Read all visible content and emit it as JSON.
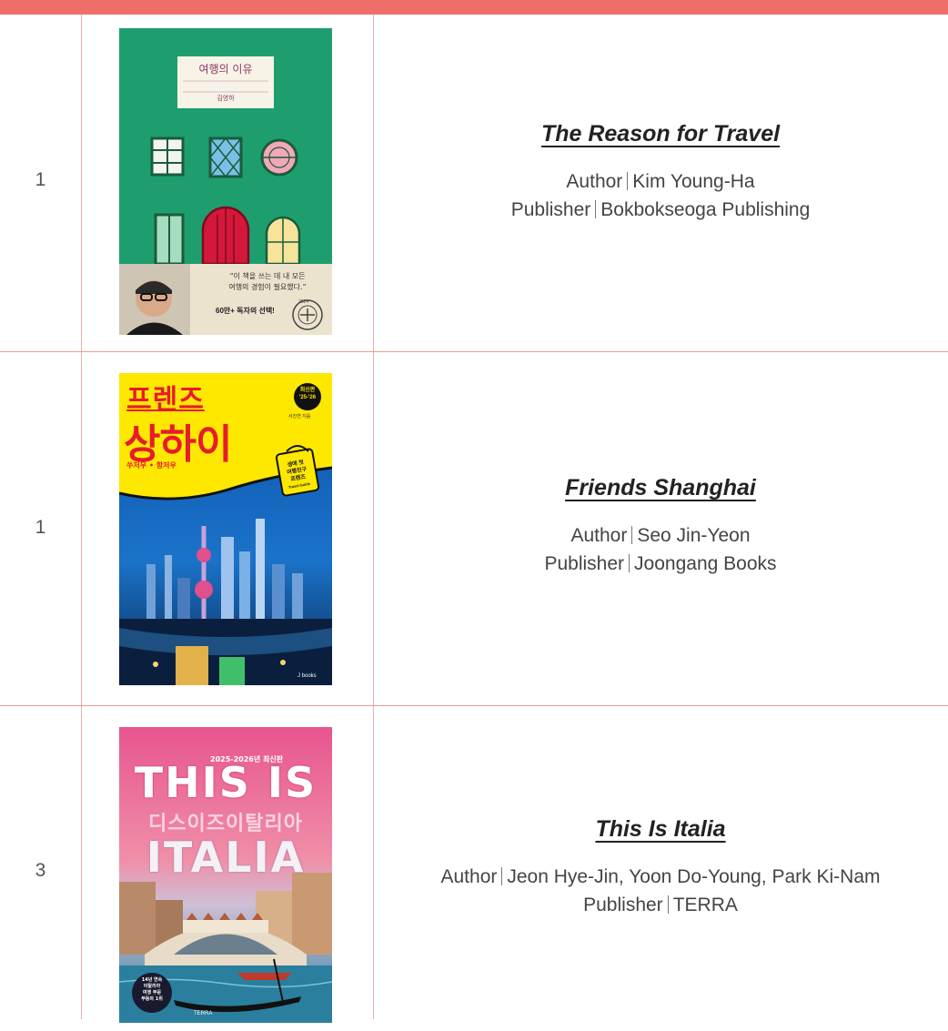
{
  "books": [
    {
      "rank": "1",
      "title": "The Reason for Travel",
      "author_label": "Author",
      "author": "Kim Young-Ha",
      "publisher_label": "Publisher",
      "publisher": "Bokbokseoga Publishing",
      "cover": {
        "title_ko": "여행의 이유",
        "author_ko": "김영하",
        "quote_line1": "“이 책을 쓰는 데 내 모든",
        "quote_line2": "여행의 경험이 필요했다.”",
        "badge": "60만+ 독자의 선택!",
        "stamp_year": "2024",
        "background": "#1e9e6e"
      }
    },
    {
      "rank": "1",
      "title": "Friends Shanghai",
      "author_label": "Author",
      "author": "Seo Jin-Yeon",
      "publisher_label": "Publisher",
      "publisher": "Joongang Books",
      "cover": {
        "series_ko": "프렌즈",
        "title_ko": "상하이",
        "subtitle_ko": "쑤저우 • 항저우",
        "edition_line1": "최신판",
        "edition_line2": "'25-'26",
        "author_ko": "서진연 지음",
        "tag_line1": "생애 첫",
        "tag_line2": "여행친구",
        "tag_line3": "프렌즈",
        "tag_line4": "Travel Guide",
        "imprint": "J books",
        "background": "#ffe800"
      }
    },
    {
      "rank": "3",
      "title": "This Is Italia",
      "author_label": "Author",
      "author": "Jeon Hye-Jin, Yoon Do-Young, Park Ki-Nam",
      "publisher_label": "Publisher",
      "publisher": "TERRA",
      "cover": {
        "edition": "2025-2026년 최신판",
        "title_line1": "THIS IS",
        "title_ko": "디스이즈이탈리아",
        "title_line2": "ITALIA",
        "badge_line1": "14년 연속",
        "badge_line2": "이탈리아",
        "badge_line3": "여행 부문",
        "badge_line4": "부동의 1위",
        "imprint": "TERRA",
        "background": "#e35a8c"
      }
    }
  ],
  "colors": {
    "accent": "#f06e6a",
    "grid": "#ec9a97"
  }
}
